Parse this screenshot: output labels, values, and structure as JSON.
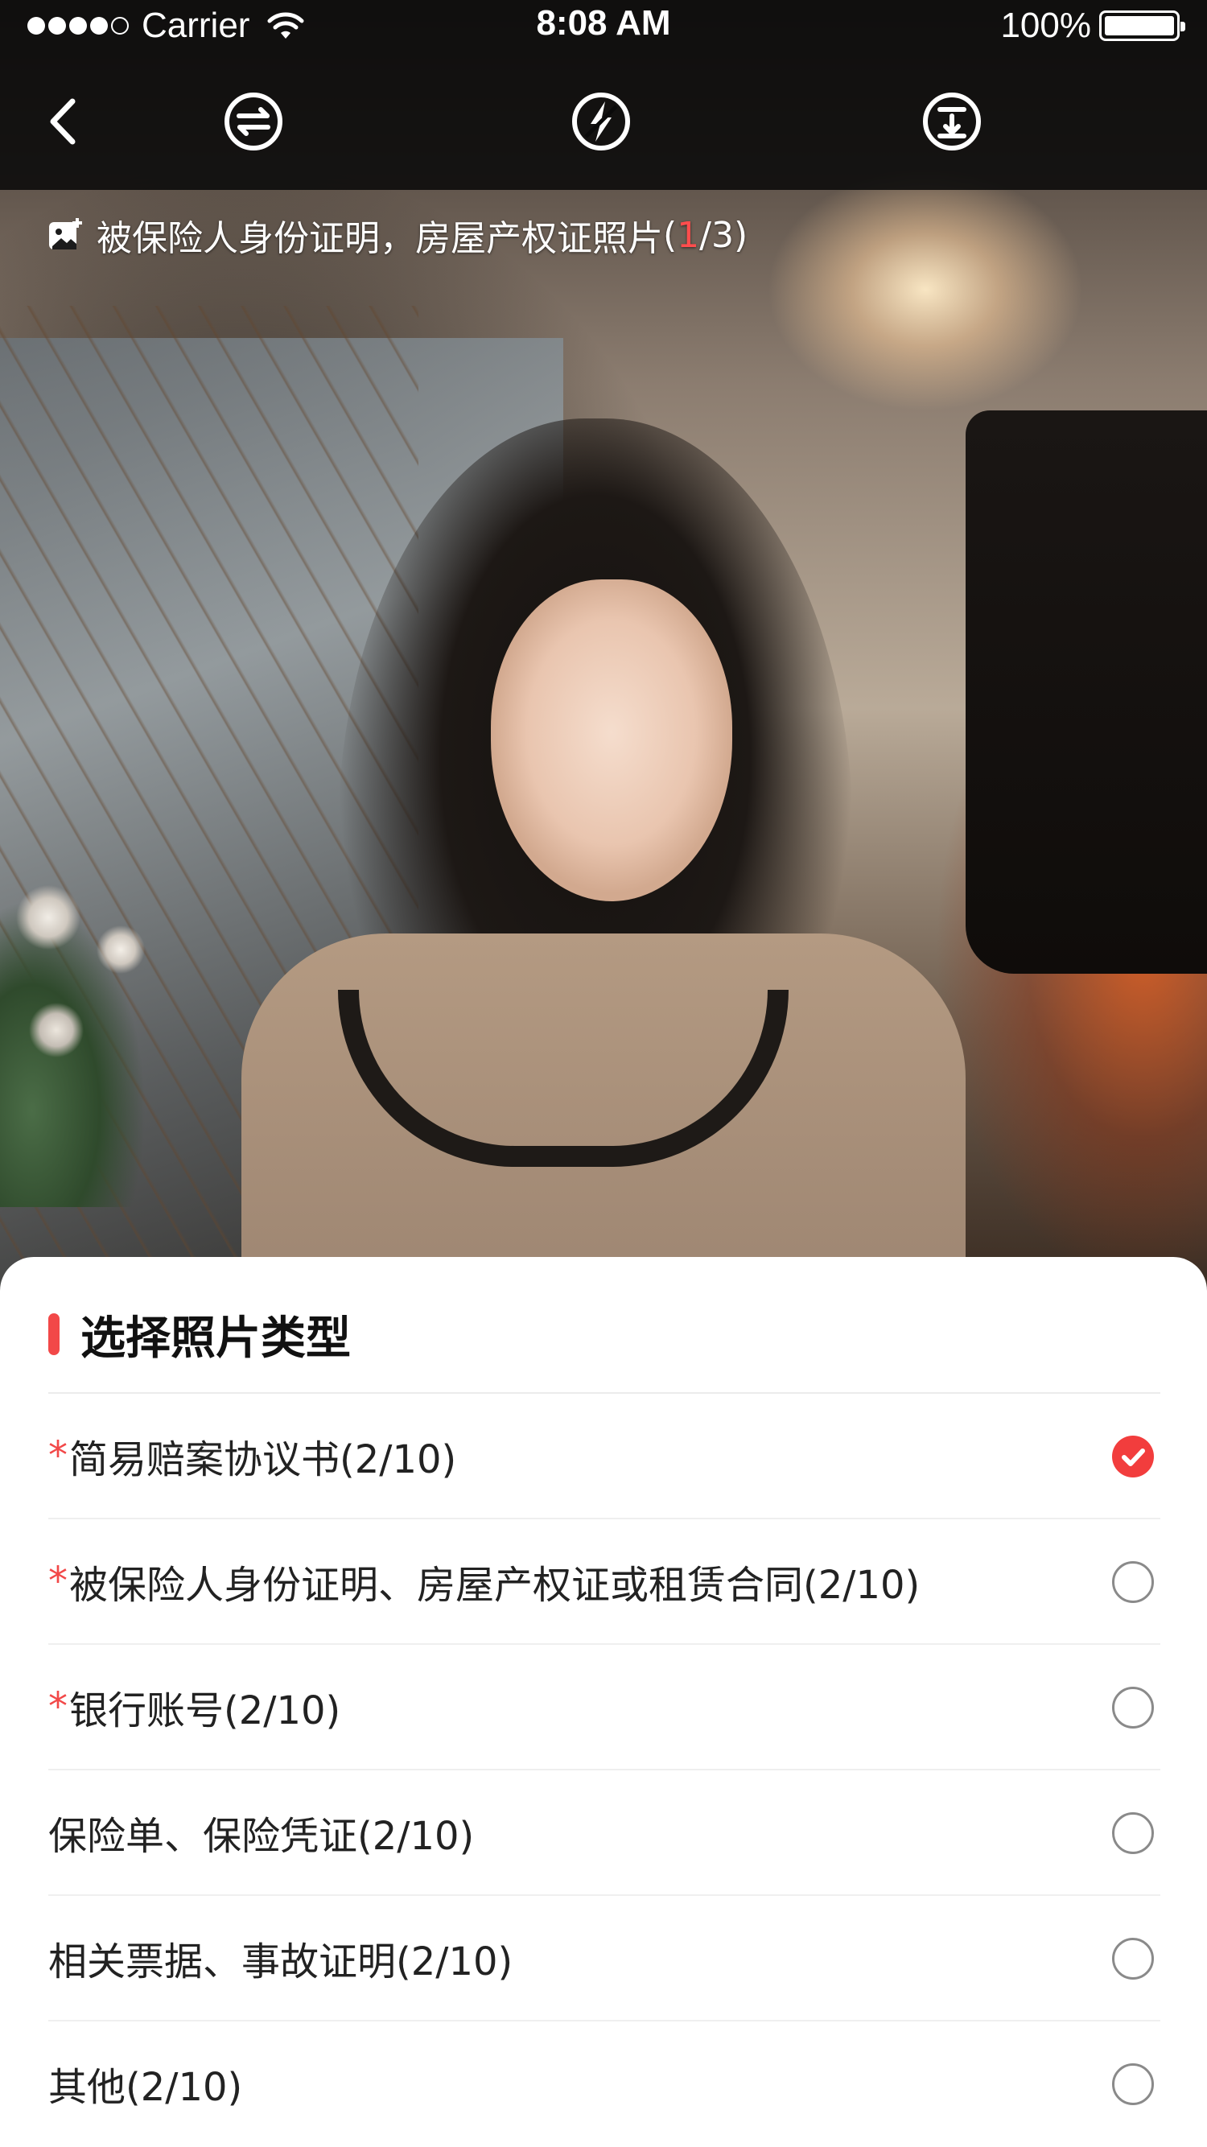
{
  "status_bar": {
    "carrier": "Carrier",
    "time": "8:08 AM",
    "battery": "100%"
  },
  "toolbar": {
    "icons": [
      "back-icon",
      "switch-camera-icon",
      "flash-off-icon",
      "download-icon"
    ]
  },
  "hint": {
    "text": "被保险人身份证明，房屋产权证照片",
    "open": "(",
    "current": "1",
    "rest": "/3)"
  },
  "sheet": {
    "title": "选择照片类型",
    "accent_color": "#f24848",
    "options": [
      {
        "required": "*",
        "label": "简易赔案协议书(2/10)",
        "checked": true
      },
      {
        "required": "*",
        "label": "被保险人身份证明、房屋产权证或租赁合同(2/10)",
        "checked": false
      },
      {
        "required": "*",
        "label": "银行账号(2/10)",
        "checked": false
      },
      {
        "required": "",
        "label": "保险单、保险凭证(2/10)",
        "checked": false
      },
      {
        "required": "",
        "label": "相关票据、事故证明(2/10)",
        "checked": false
      },
      {
        "required": "",
        "label": "其他(2/10)",
        "checked": false
      }
    ]
  }
}
